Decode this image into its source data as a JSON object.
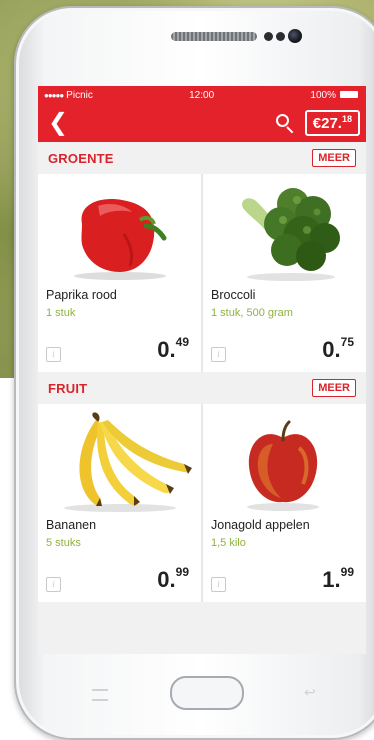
{
  "status": {
    "carrier": "Picnic",
    "time": "12:00",
    "battery": "100%"
  },
  "topbar": {
    "cart_euros": "€27.",
    "cart_cents": "18"
  },
  "sections": [
    {
      "title": "GROENTE",
      "more_label": "MEER",
      "products": [
        {
          "name": "Paprika rood",
          "quantity": "1 stuk",
          "price_whole": "0.",
          "price_cents": "49",
          "icon": "red-bell-pepper"
        },
        {
          "name": "Broccoli",
          "quantity": "1 stuk, 500 gram",
          "price_whole": "0.",
          "price_cents": "75",
          "icon": "broccoli"
        }
      ]
    },
    {
      "title": "FRUIT",
      "more_label": "MEER",
      "products": [
        {
          "name": "Bananen",
          "quantity": "5 stuks",
          "price_whole": "0.",
          "price_cents": "99",
          "icon": "banana-bunch"
        },
        {
          "name": "Jonagold appelen",
          "quantity": "1,5 kilo",
          "price_whole": "1.",
          "price_cents": "99",
          "icon": "red-apple"
        }
      ]
    }
  ],
  "info_glyph": "i",
  "colors": {
    "brand_red": "#e4222b",
    "quantity_green": "#8eb33c"
  }
}
